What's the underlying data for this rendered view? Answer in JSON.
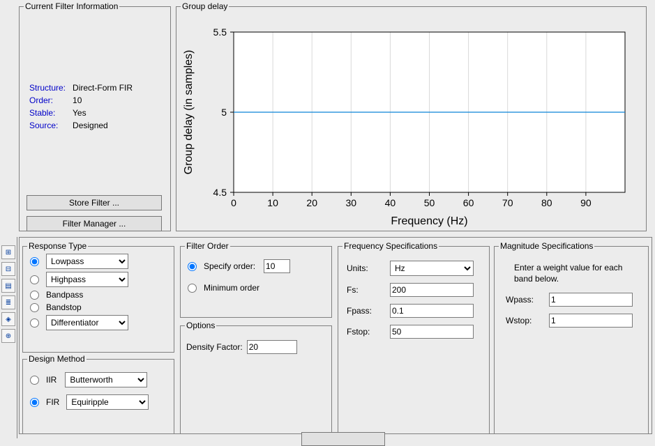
{
  "filter_info": {
    "legend": "Current Filter Information",
    "structure_label": "Structure:",
    "structure_value": "Direct-Form FIR",
    "order_label": "Order:",
    "order_value": "10",
    "stable_label": "Stable:",
    "stable_value": "Yes",
    "source_label": "Source:",
    "source_value": "Designed",
    "store_btn": "Store Filter ...",
    "manager_btn": "Filter Manager ..."
  },
  "group_delay": {
    "legend": "Group delay",
    "xlabel": "Frequency (Hz)",
    "ylabel": "Group delay (in samples)"
  },
  "chart_data": {
    "type": "line",
    "title": "",
    "xlabel": "Frequency (Hz)",
    "ylabel": "Group delay (in samples)",
    "xlim": [
      0,
      100
    ],
    "ylim": [
      4.5,
      5.5
    ],
    "xticks": [
      0,
      10,
      20,
      30,
      40,
      50,
      60,
      70,
      80,
      90
    ],
    "yticks": [
      4.5,
      5,
      5.5
    ],
    "series": [
      {
        "name": "Group delay",
        "x": [
          0,
          10,
          20,
          30,
          40,
          50,
          60,
          70,
          80,
          90,
          100
        ],
        "y": [
          5,
          5,
          5,
          5,
          5,
          5,
          5,
          5,
          5,
          5,
          5
        ],
        "color": "#0B84D8"
      }
    ]
  },
  "response_type": {
    "legend": "Response Type",
    "lowpass": "Lowpass",
    "highpass": "Highpass",
    "bandpass": "Bandpass",
    "bandstop": "Bandstop",
    "differentiator": "Differentiator"
  },
  "design_method": {
    "legend": "Design Method",
    "iir": "IIR",
    "iir_value": "Butterworth",
    "fir": "FIR",
    "fir_value": "Equiripple"
  },
  "filter_order": {
    "legend": "Filter Order",
    "specify": "Specify order:",
    "specify_value": "10",
    "minimum": "Minimum order"
  },
  "options": {
    "legend": "Options",
    "density_label": "Density Factor:",
    "density_value": "20"
  },
  "freq_spec": {
    "legend": "Frequency Specifications",
    "units_label": "Units:",
    "units_value": "Hz",
    "fs_label": "Fs:",
    "fs_value": "200",
    "fpass_label": "Fpass:",
    "fpass_value": "0.1",
    "fstop_label": "Fstop:",
    "fstop_value": "50"
  },
  "mag_spec": {
    "legend": "Magnitude Specifications",
    "hint": "Enter a weight value for each band below.",
    "wpass_label": "Wpass:",
    "wpass_value": "1",
    "wstop_label": "Wstop:",
    "wstop_value": "1"
  }
}
